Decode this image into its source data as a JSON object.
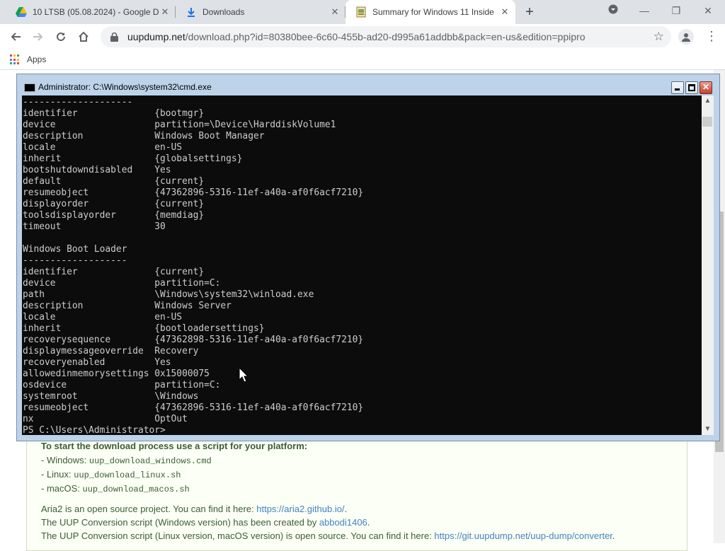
{
  "browser": {
    "tabs": [
      {
        "title": "10 LTSB (05.08.2024) - Google D",
        "icon": "google-drive-icon",
        "active": false
      },
      {
        "title": "Downloads",
        "icon": "download-icon",
        "active": false
      },
      {
        "title": "Summary for Windows 11 Inside",
        "icon": "uupdump-icon",
        "active": true
      }
    ],
    "new_tab": "+",
    "url_host": "uupdump.net",
    "url_rest": "/download.php?id=80380bee-6c60-455b-ad20-d995a61addbb&pack=en-us&edition=ppipro",
    "bookmarks": {
      "apps_label": "Apps"
    },
    "colors": {
      "tabbar": "#dee1e6",
      "omnibox": "#f1f3f4"
    }
  },
  "cmd": {
    "title": "Administrator: C:\\Windows\\system32\\cmd.exe",
    "lines": [
      "--------------------",
      "identifier              {bootmgr}",
      "device                  partition=\\Device\\HarddiskVolume1",
      "description             Windows Boot Manager",
      "locale                  en-US",
      "inherit                 {globalsettings}",
      "bootshutdowndisabled    Yes",
      "default                 {current}",
      "resumeobject            {47362896-5316-11ef-a40a-af0f6acf7210}",
      "displayorder            {current}",
      "toolsdisplayorder       {memdiag}",
      "timeout                 30",
      "",
      "Windows Boot Loader",
      "-------------------",
      "identifier              {current}",
      "device                  partition=C:",
      "path                    \\Windows\\system32\\winload.exe",
      "description             Windows Server",
      "locale                  en-US",
      "inherit                 {bootloadersettings}",
      "recoverysequence        {47362898-5316-11ef-a40a-af0f6acf7210}",
      "displaymessageoverride  Recovery",
      "recoveryenabled         Yes",
      "allowedinmemorysettings 0x15000075",
      "osdevice                partition=C:",
      "systemroot              \\Windows",
      "resumeobject            {47362896-5316-11ef-a40a-af0f6acf7210}",
      "nx                      OptOut",
      "PS C:\\Users\\Administrator>"
    ]
  },
  "page": {
    "heading": "To start the download process use a script for your platform:",
    "windows_label": "- Windows: ",
    "windows_script": "uup_download_windows.cmd",
    "linux_label": "- Linux: ",
    "linux_script": "uup_download_linux.sh",
    "macos_label": "- macOS: ",
    "macos_script": "uup_download_macos.sh",
    "aria_text": "Aria2 is an open source project. You can find it here: ",
    "aria_link": "https://aria2.github.io/",
    "aria_end": ".",
    "conv_win_text": "The UUP Conversion script (Windows version) has been created by ",
    "conv_win_link": "abbodi1406",
    "conv_win_end": ".",
    "conv_lin_text": "The UUP Conversion script (Linux version, macOS version) is open source. You can find it here: ",
    "conv_lin_link": "https://git.uupdump.net/uup-dump/converter",
    "conv_lin_end": "."
  }
}
